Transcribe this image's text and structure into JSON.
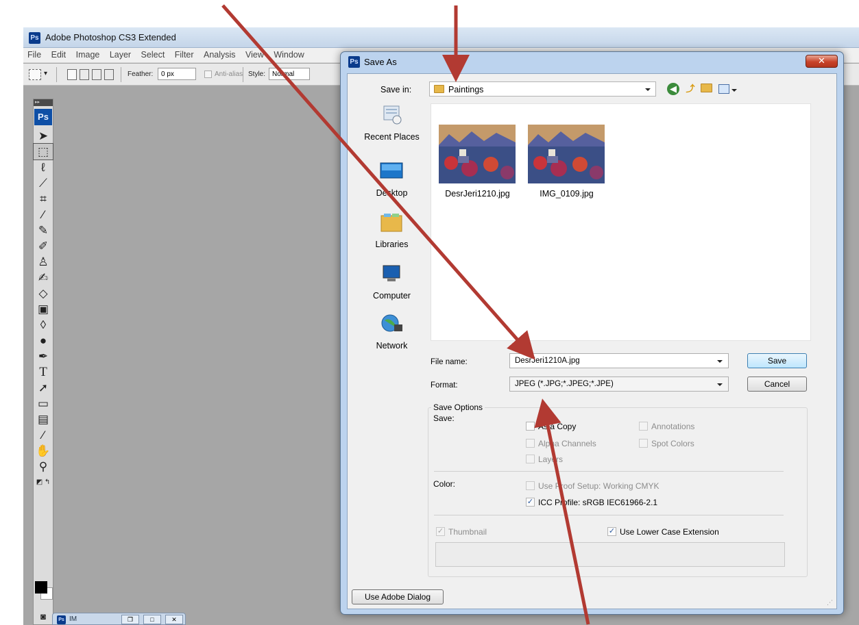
{
  "photoshop": {
    "title": "Adobe Photoshop CS3 Extended",
    "app_logo": "Ps",
    "menu": [
      "File",
      "Edit",
      "Image",
      "Layer",
      "Select",
      "Filter",
      "Analysis",
      "View",
      "Window"
    ],
    "options_bar": {
      "feather_label": "Feather:",
      "feather_value": "0 px",
      "anti_alias_label": "Anti-alias",
      "style_label": "Style:",
      "style_value": "Normal"
    },
    "toolbar_collapse": "▸▸",
    "doc_tab": {
      "logo": "Ps",
      "name": "IM"
    }
  },
  "dialog": {
    "title": "Save As",
    "logo": "Ps",
    "close_label": "✕",
    "save_in": {
      "label": "Save in:",
      "value": "Paintings"
    },
    "places": [
      {
        "label": "Recent Places",
        "icon": "recent-places-icon"
      },
      {
        "label": "Desktop",
        "icon": "desktop-icon"
      },
      {
        "label": "Libraries",
        "icon": "libraries-icon"
      },
      {
        "label": "Computer",
        "icon": "computer-icon"
      },
      {
        "label": "Network",
        "icon": "network-icon"
      }
    ],
    "files": [
      {
        "name": "DesrJeri1210.jpg"
      },
      {
        "name": "IMG_0109.jpg"
      }
    ],
    "file_name": {
      "label": "File name:",
      "value": "DesrJeri1210A.jpg"
    },
    "format": {
      "label": "Format:",
      "value": "JPEG (*.JPG;*.JPEG;*.JPE)"
    },
    "buttons": {
      "save": "Save",
      "cancel": "Cancel",
      "use_adobe_dialog": "Use Adobe Dialog"
    },
    "save_options": {
      "title": "Save Options",
      "save_label": "Save:",
      "as_a_copy": "As a Copy",
      "annotations": "Annotations",
      "alpha_channels": "Alpha Channels",
      "spot_colors": "Spot Colors",
      "layers": "Layers",
      "color_label": "Color:",
      "use_proof_setup": "Use Proof Setup:  Working CMYK",
      "icc_profile": "ICC Profile:  sRGB IEC61966-2.1",
      "thumbnail": "Thumbnail",
      "use_lower_case_extension": "Use Lower Case Extension"
    }
  },
  "colors": {
    "arrow": "#b23a32",
    "dialog_frame": "#bcd3ee",
    "ps_workspace": "#a6a6a6"
  }
}
